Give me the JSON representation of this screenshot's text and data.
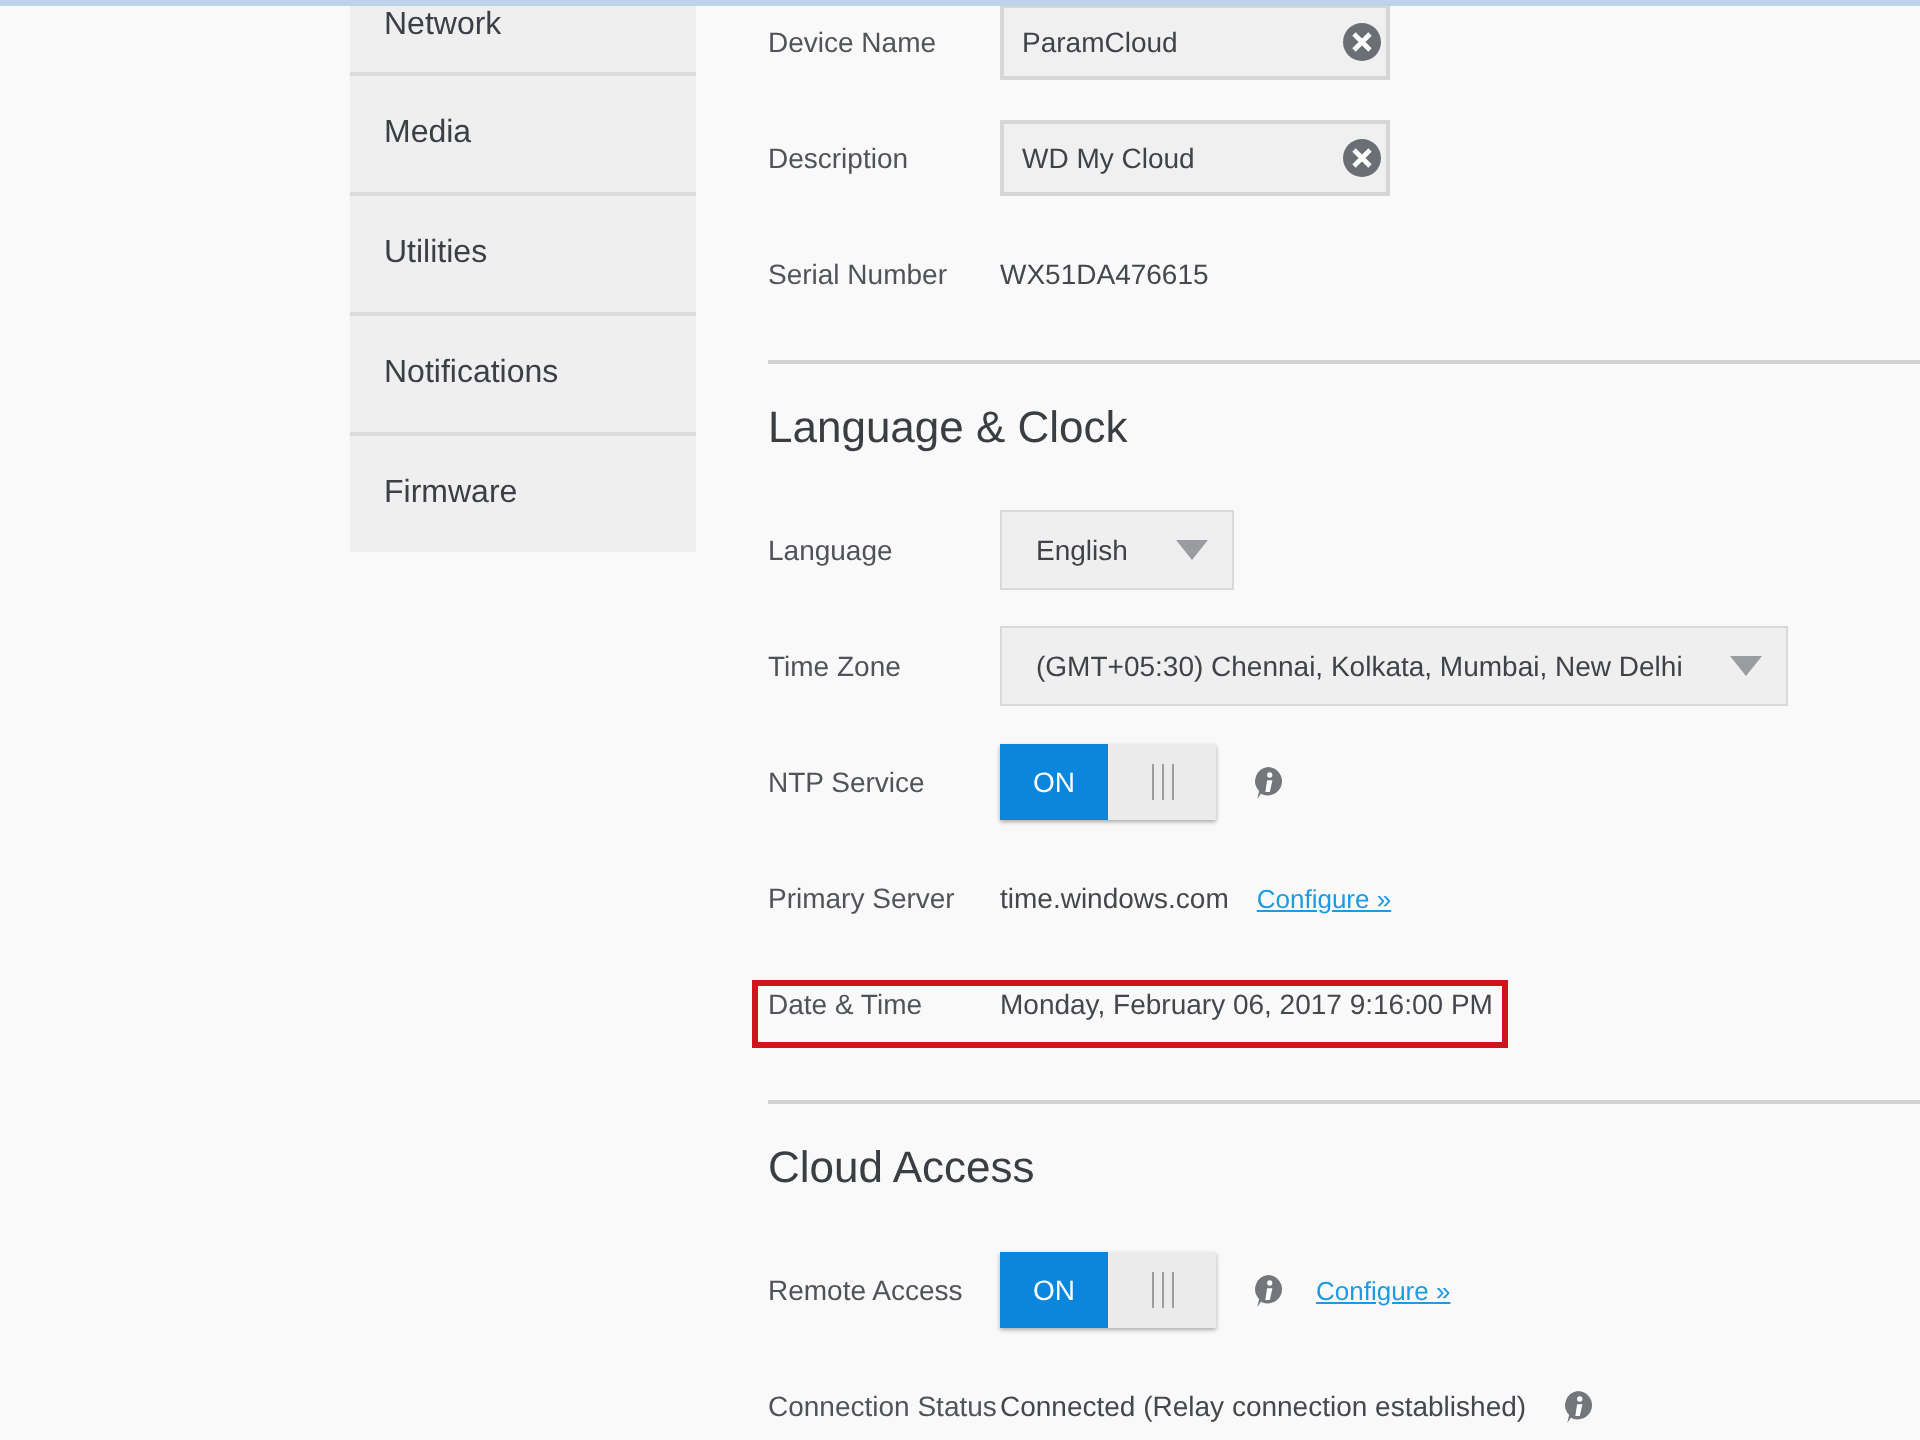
{
  "sidebar": {
    "items": [
      {
        "label": "Network"
      },
      {
        "label": "Media"
      },
      {
        "label": "Utilities"
      },
      {
        "label": "Notifications"
      },
      {
        "label": "Firmware"
      }
    ]
  },
  "sections": [
    {
      "rows": [
        {
          "kind": "field",
          "label": "Device Name",
          "value": "ParamCloud"
        },
        {
          "kind": "field",
          "label": "Description",
          "value": "WD My Cloud"
        },
        {
          "kind": "text",
          "label": "Serial Number",
          "value": "WX51DA476615"
        }
      ]
    },
    {
      "title": "Language & Clock",
      "rows": [
        {
          "kind": "select",
          "label": "Language",
          "value": "English"
        },
        {
          "kind": "select",
          "label": "Time Zone",
          "value": "(GMT+05:30) Chennai, Kolkata, Mumbai, New Delhi"
        },
        {
          "kind": "toggle",
          "label": "NTP Service",
          "on": true,
          "on_label": "ON",
          "info": true
        },
        {
          "kind": "text",
          "label": "Primary Server",
          "value": "time.windows.com",
          "link": "Configure »"
        },
        {
          "kind": "text",
          "label": "Date & Time",
          "value": "Monday, February 06, 2017 9:16:00 PM",
          "highlighted": true
        }
      ]
    },
    {
      "title": "Cloud Access",
      "rows": [
        {
          "kind": "toggle",
          "label": "Remote Access",
          "on": true,
          "on_label": "ON",
          "info": true,
          "link": "Configure »"
        },
        {
          "kind": "text",
          "label": "Connection Status",
          "value": "Connected (Relay connection established)",
          "info": true
        }
      ]
    }
  ]
}
